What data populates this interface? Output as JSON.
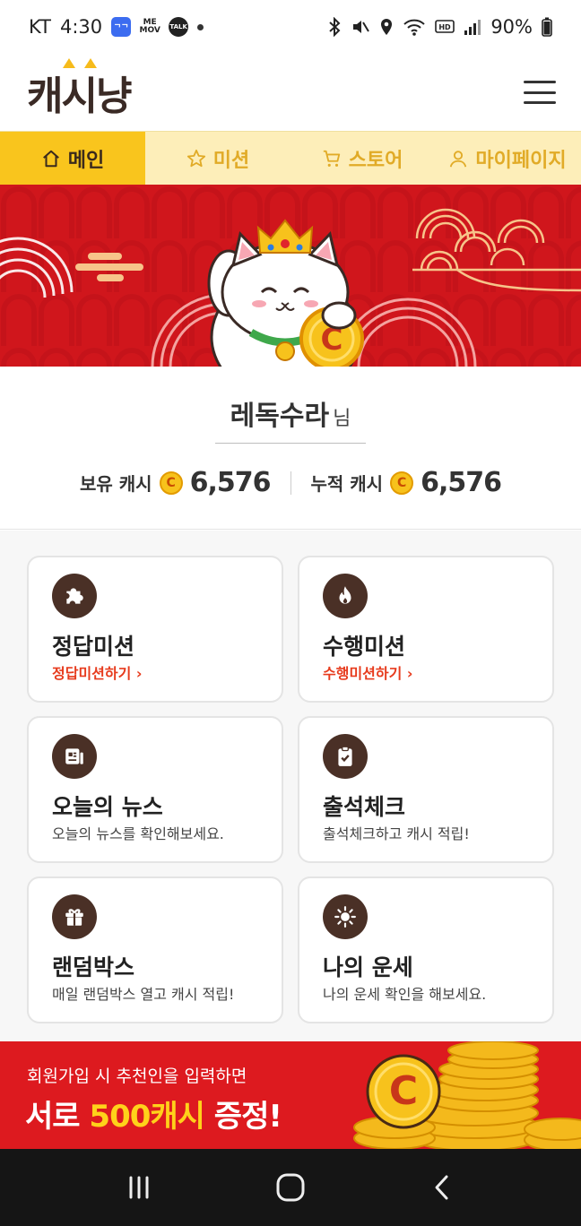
{
  "status_bar": {
    "carrier": "KT",
    "time": "4:30",
    "apps": [
      "ᄀᄀ",
      "ME MOV",
      "TALK"
    ],
    "battery": "90%"
  },
  "header": {
    "logo": "캐시냥",
    "menu_icon": "hamburger-menu-icon"
  },
  "tabs": [
    {
      "label": "메인",
      "icon": "home-icon",
      "active": true
    },
    {
      "label": "미션",
      "icon": "star-icon",
      "active": false
    },
    {
      "label": "스토어",
      "icon": "cart-icon",
      "active": false
    },
    {
      "label": "마이페이지",
      "icon": "user-icon",
      "active": false
    }
  ],
  "user": {
    "name": "레독수라",
    "suffix": "님",
    "owned_label": "보유 캐시",
    "owned_value": "6,576",
    "total_label": "누적 캐시",
    "total_value": "6,576",
    "coin_symbol": "C"
  },
  "cards": [
    {
      "title": "정답미션",
      "sub": "정답미션하기 ›",
      "icon": "puzzle-icon",
      "link": true
    },
    {
      "title": "수행미션",
      "sub": "수행미션하기 ›",
      "icon": "fire-icon",
      "link": true
    },
    {
      "title": "오늘의 뉴스",
      "sub": "오늘의 뉴스를 확인해보세요.",
      "icon": "news-icon",
      "link": false
    },
    {
      "title": "출석체크",
      "sub": "출석체크하고 캐시 적립!",
      "icon": "clipboard-check-icon",
      "link": false
    },
    {
      "title": "랜덤박스",
      "sub": "매일 랜덤박스 열고 캐시 적립!",
      "icon": "gift-icon",
      "link": false
    },
    {
      "title": "나의 운세",
      "sub": "나의 운세 확인을 해보세요.",
      "icon": "sun-icon",
      "link": false
    }
  ],
  "promo": {
    "line1": "회원가입 시 추천인을 입력하면",
    "line2_a": "서로 ",
    "line2_hl": "500캐시",
    "line2_b": " 증정!",
    "coin_symbol": "C"
  },
  "colors": {
    "tab_active": "#f9c51d",
    "tab_bg": "#fdeeb9",
    "banner_red": "#d0161c",
    "card_icon": "#4a3026",
    "accent_link": "#e73b1d",
    "promo_highlight": "#ffd11a"
  }
}
